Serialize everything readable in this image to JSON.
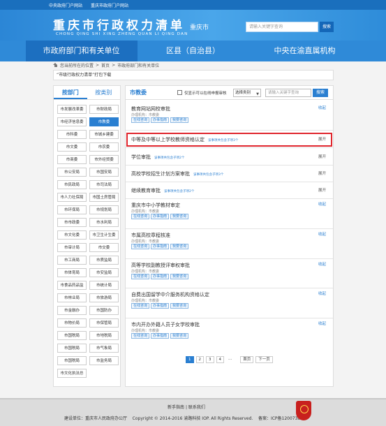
{
  "topbar": {
    "links": [
      "中央政府门户网站",
      "重庆市政府门户网站"
    ]
  },
  "banner": {
    "title_cn": "重庆市行政权力清单",
    "title_pinyin": "CHONG QING SHI  XING ZHENG QUAN LI QING DAN",
    "city": "重庆市",
    "search_placeholder": "请输入关键字查询",
    "search_button": "搜索"
  },
  "nav": {
    "items": [
      "市政府部门和有关单位",
      "区县（自治县）",
      "中央在渝直属机构"
    ]
  },
  "breadcrumb": {
    "prefix": "您当前所在的位置",
    "items": [
      "首页",
      "市政府部门和有关单位"
    ],
    "separator": ">"
  },
  "download_bar": "“市级行政权力清单”打包下载",
  "left": {
    "tabs": [
      "按部门",
      "按类别"
    ],
    "depts": [
      "市发展改革委",
      "市财政局",
      "市经济信息委",
      "市教委",
      "市科委",
      "市城乡建委",
      "市文委",
      "市农委",
      "市商委",
      "市外经贸委",
      "市公安局",
      "市国安局",
      "市民政局",
      "市司法局",
      "市人力社保局",
      "市国土房管局",
      "市环保局",
      "市规划局",
      "市市政委",
      "市水利局",
      "市文化委",
      "市卫生计生委",
      "市审计局",
      "市交委",
      "市工商局",
      "市质监局",
      "市体育局",
      "市安监局",
      "市食品药品监",
      "市统计局",
      "市林业局",
      "市旅游局",
      "市金融办",
      "市国防办",
      "市物价局",
      "市保管局",
      "市国税局",
      "市地税局",
      "市国税局",
      "市气象局",
      "市国税局",
      "市监务局",
      "市文化执法总"
    ]
  },
  "right": {
    "title": "市教委",
    "checkbox_label": "仅显示可以在线申报审核",
    "select_value": "选择类别",
    "search_placeholder": "请输入关键字查询",
    "search_button": "搜索",
    "items": [
      {
        "title": "教育网站网校审批",
        "meta": "办理机构：市教委",
        "buttons": [
          "在线咨询",
          "办事指南",
          "我要咨询"
        ],
        "toggle": "收起",
        "sub": ""
      },
      {
        "title": "中等及中等以上学校教师资格认定",
        "meta": "",
        "buttons": [],
        "toggle": "展开",
        "sub": "该事项共包含子项3个"
      },
      {
        "title": "学位审批",
        "meta": "",
        "buttons": [],
        "toggle": "展开",
        "sub": "该事项共包含子项2个"
      },
      {
        "title": "高校学校招生计划方案审批",
        "meta": "",
        "buttons": [],
        "toggle": "展开",
        "sub": "该事项共包含子项3个"
      },
      {
        "title": "继续教育审批",
        "meta": "",
        "buttons": [],
        "toggle": "展开",
        "sub": "该事项共包含子项2个"
      },
      {
        "title": "重庆市中小学教材审定",
        "meta": "办理机构：市教委",
        "buttons": [
          "在线咨询",
          "办事指南",
          "我要咨询"
        ],
        "toggle": "收起",
        "sub": ""
      },
      {
        "title": "市属高校章程核准",
        "meta": "办理机构：市教委",
        "buttons": [
          "在线咨询",
          "办事指南",
          "我要咨询"
        ],
        "toggle": "收起",
        "sub": ""
      },
      {
        "title": "高等学校副教授评审权审批",
        "meta": "办理机构：市教委",
        "buttons": [
          "在线咨询",
          "办事指南",
          "我要咨询"
        ],
        "toggle": "收起",
        "sub": ""
      },
      {
        "title": "自费出国留学中介服务机构资格认定",
        "meta": "办理机构：市教委",
        "buttons": [
          "在线咨询",
          "办事指南",
          "我要咨询"
        ],
        "toggle": "收起",
        "sub": ""
      },
      {
        "title": "市内开办外籍人员子女学校审批",
        "meta": "办理机构：市教委",
        "buttons": [
          "在线咨询",
          "办事指南",
          "我要咨询"
        ],
        "toggle": "收起",
        "sub": ""
      }
    ]
  },
  "pagination": {
    "pages": [
      "1",
      "2",
      "3",
      "4"
    ],
    "ellipsis": "...",
    "prev": "首页",
    "next": "下一页",
    "current": 0
  },
  "footer": {
    "links": [
      "新手指南",
      "联系我们"
    ],
    "sponsor": "建设单位：重庆市人民政府办公厅",
    "copyright": "Copyright © 2014-2016 渝路科技 IOP. All Rights Reserved.",
    "icp": "备案：ICP备12007387号"
  }
}
